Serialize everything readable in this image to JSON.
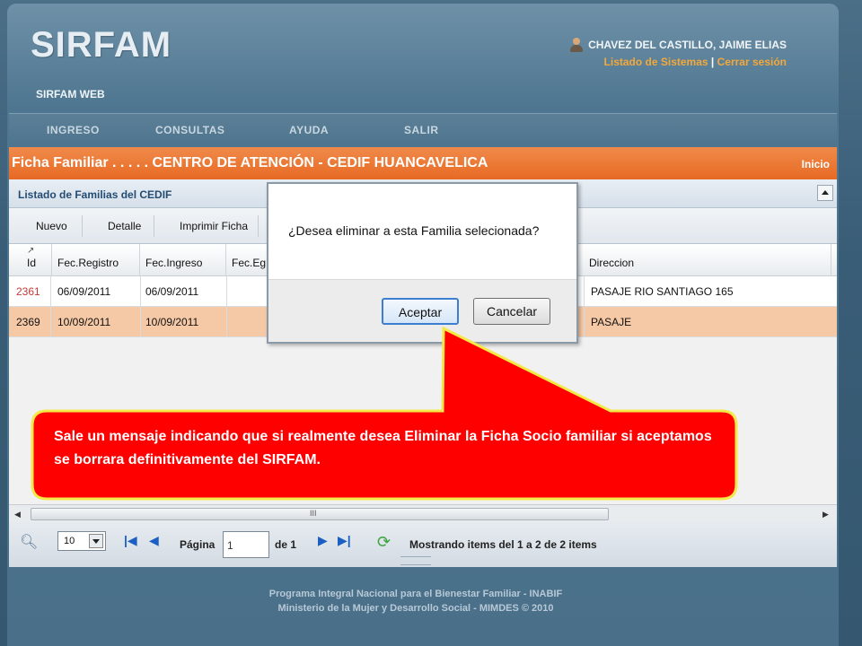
{
  "app": {
    "logo": "SIRFAM",
    "subtitle": "SIRFAM WEB",
    "user_name": "CHAVEZ DEL CASTILLO, JAIME ELIAS",
    "link_systems": "Listado de Sistemas",
    "link_separator": "|",
    "link_logout": "Cerrar sesión"
  },
  "menu": [
    "INGRESO",
    "CONSULTAS",
    "AYUDA",
    "SALIR"
  ],
  "page": {
    "title": "Ficha Familiar . . . . . CENTRO DE ATENCIÓN - CEDIF HUANCAVELICA",
    "home_link": "Inicio",
    "panel_title": "Listado de Familias del CEDIF"
  },
  "toolbar": {
    "buttons": [
      "Nuevo",
      "Detalle",
      "Imprimir Ficha"
    ]
  },
  "grid": {
    "columns": [
      "Id",
      "Fec.Registro",
      "Fec.Ingreso",
      "Fec.Eg",
      "Direccion"
    ],
    "rows": [
      {
        "id": "2361",
        "fec_registro": "06/09/2011",
        "fec_ingreso": "06/09/2011",
        "direccion": "PASAJE RIO SANTIAGO 165"
      },
      {
        "id": "2369",
        "fec_registro": "10/09/2011",
        "fec_ingreso": "10/09/2011",
        "direccion": "PASAJE"
      }
    ],
    "selected_row_color": "#f6c9a6",
    "scroll_grip": "III"
  },
  "pager": {
    "page_size": "10",
    "page_label": "Página",
    "page_value": "1",
    "of_label": "de 1",
    "status": "Mostrando items del 1 a 2 de 2 items"
  },
  "dialog": {
    "message": "¿Desea eliminar a esta Familia selecionada?",
    "ok_label": "Aceptar",
    "cancel_label": "Cancelar"
  },
  "callout": {
    "text": "Sale un mensaje indicando que si realmente desea Eliminar la Ficha Socio familiar  si aceptamos se borrara definitivamente del SIRFAM.",
    "fill_color": "#ff0000",
    "border_color": "#f5e94a"
  },
  "footer": {
    "line1": "Programa Integral Nacional para el Bienestar Familiar - INABIF",
    "line2": "Ministerio de la Mujer y Desarrollo Social - MIMDES © 2010"
  },
  "colors": {
    "orange_bar": "#e76a24",
    "link_orange": "#f2a83a",
    "panel_title": "#244c73"
  }
}
